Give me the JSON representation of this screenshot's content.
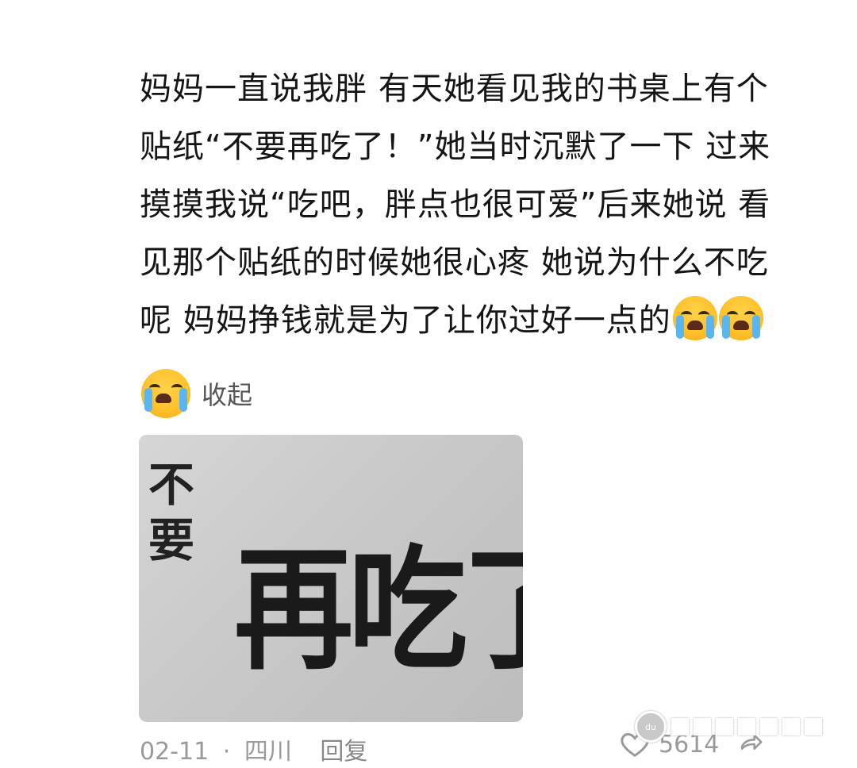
{
  "comment": {
    "lines": [
      "妈妈一直说我胖 有天她看见我的书桌上有个",
      "贴纸“不要再吃了！”她当时沉默了一下 过来",
      "摸摸我说“吃吧，胖点也很可爱”后来她说 看",
      "见那个贴纸的时候她很心疼 她说为什么不吃",
      "呢 妈妈挣钱就是为了让你过好一点的"
    ],
    "trailing_emoji": "loudly-crying-face-icon"
  },
  "collapse": {
    "label": "收起",
    "emoji": "loudly-crying-face-icon"
  },
  "photo": {
    "small_text": [
      "不",
      "要"
    ],
    "big_text": "再吃了"
  },
  "meta": {
    "date": "02-11",
    "separator": "·",
    "location": "四川",
    "reply_label": "回复"
  },
  "likes": {
    "count": "5614",
    "like_icon": "heart-icon",
    "share_icon": "share-icon"
  },
  "colors": {
    "text": "#151515",
    "meta_text": "#9a9a9a",
    "emoji_yellow": "#ffc22c",
    "tear_blue": "#5ab6f0"
  }
}
